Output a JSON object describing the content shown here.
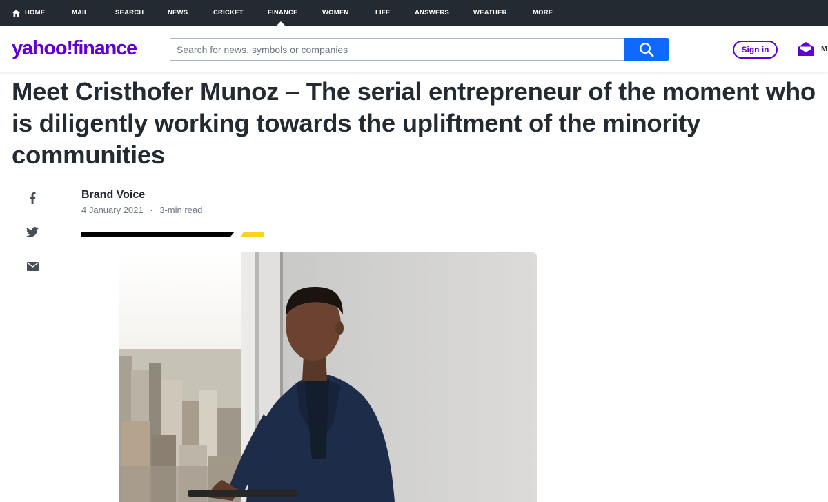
{
  "topnav": {
    "items": [
      "HOME",
      "MAIL",
      "SEARCH",
      "NEWS",
      "CRICKET",
      "FINANCE",
      "WOMEN",
      "LIFE",
      "ANSWERS",
      "WEATHER",
      "MORE"
    ],
    "active": "FINANCE"
  },
  "header": {
    "logo_text": "yahoo!finance",
    "search_placeholder": "Search for news, symbols or companies",
    "signin_label": "Sign in",
    "mail_label": "M"
  },
  "article": {
    "headline": "Meet Cristhofer Munoz – The serial entrepreneur of the moment who is diligently working towards the upliftment of the minority communities",
    "author": "Brand Voice",
    "date": "4 January 2021",
    "separator": "·",
    "read_time": "3-min read"
  },
  "share": {
    "icons": [
      "facebook-icon",
      "twitter-icon",
      "email-icon"
    ]
  },
  "colors": {
    "nav_bg": "#232a31",
    "brand_purple": "#6001d2",
    "search_blue": "#0f69ff",
    "accent_yellow": "#ffd026"
  }
}
